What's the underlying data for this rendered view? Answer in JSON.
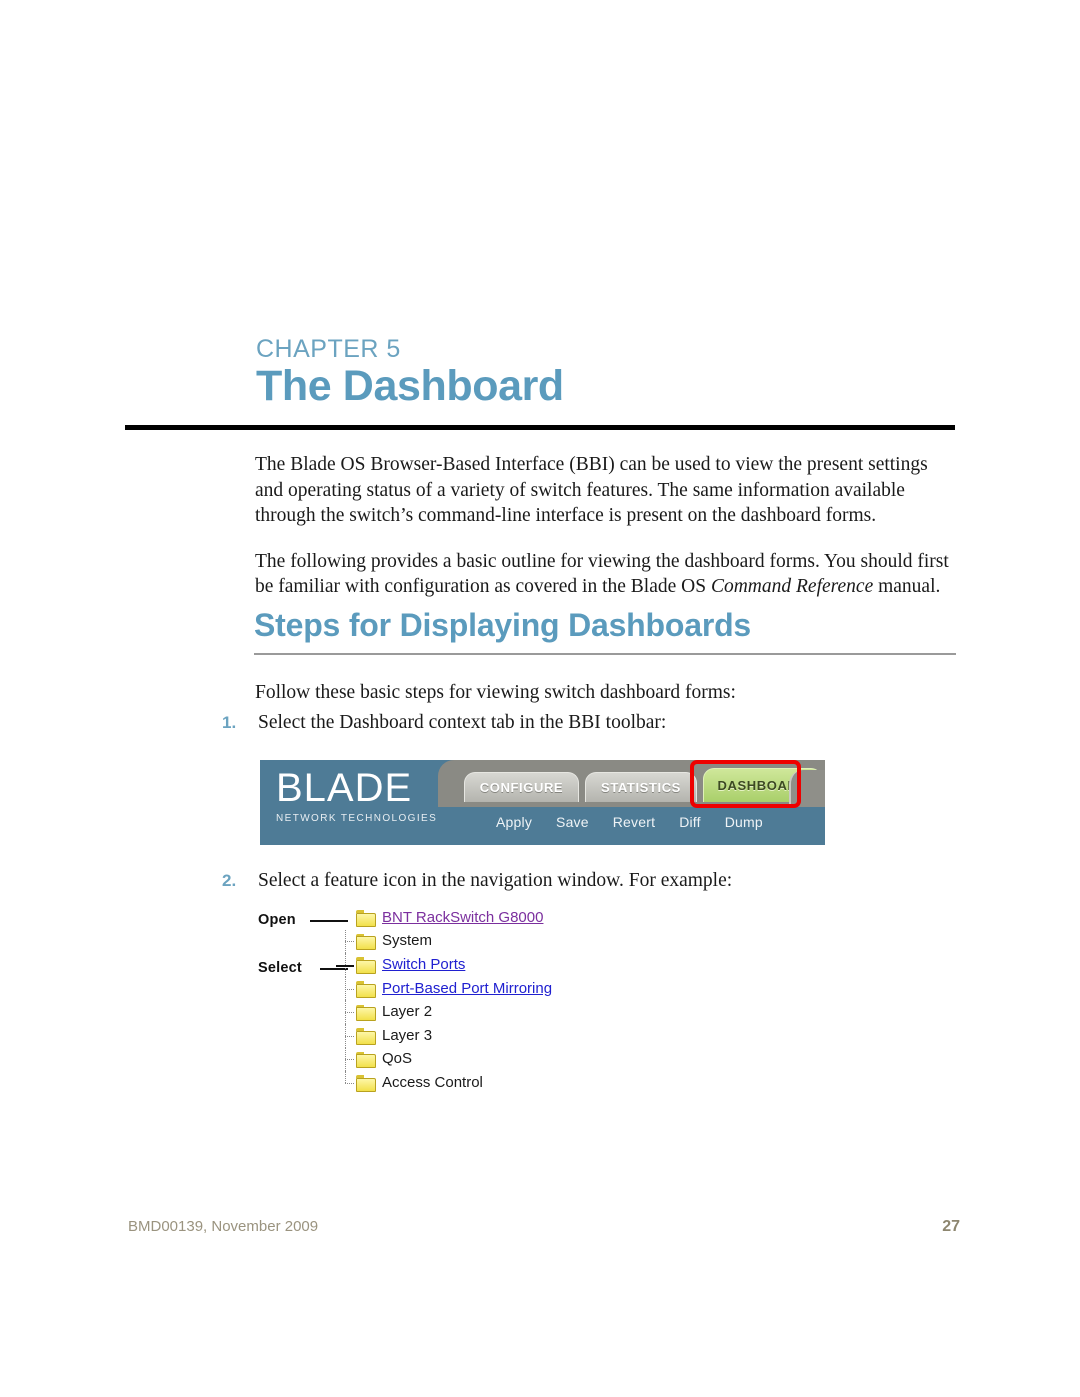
{
  "chapter": {
    "label_word": "Chapter",
    "number": "5",
    "title": "The Dashboard"
  },
  "intro": {
    "para1": "The Blade OS Browser-Based Interface (BBI) can be used to view the present settings and operating status of a variety of switch features. The same information available through the switch’s command-line interface is present on the dashboard forms.",
    "para2_before": "The following provides a basic outline for viewing the dashboard forms. You should first be familiar with configuration as covered in the Blade OS ",
    "para2_italic": "Command Reference",
    "para2_after": " manual."
  },
  "section": {
    "title": "Steps for Displaying Dashboards",
    "lead_in": "Follow these basic steps for viewing switch dashboard forms:"
  },
  "steps": [
    {
      "number": "1.",
      "text": "Select the Dashboard context tab in the BBI toolbar:"
    },
    {
      "number": "2.",
      "text": "Select a feature icon in the navigation window. For example:"
    }
  ],
  "bbi_toolbar": {
    "logo_word": "BLADE",
    "logo_tagline": "NETWORK TECHNOLOGIES",
    "tabs": [
      {
        "label": "CONFIGURE",
        "active": "false"
      },
      {
        "label": "STATISTICS",
        "active": "false"
      },
      {
        "label": "DASHBOARD",
        "active": "true"
      }
    ],
    "actions": [
      "Apply",
      "Save",
      "Revert",
      "Diff",
      "Dump"
    ],
    "highlight_color": "#ee0000",
    "background_color": "#4e7b96",
    "active_tab_color": "#a9cf6a"
  },
  "nav_tree": {
    "callouts": [
      {
        "label": "Open"
      },
      {
        "label": "Select"
      }
    ],
    "items": [
      {
        "label": "BNT RackSwitch G8000",
        "style": "link-visited",
        "level": "root"
      },
      {
        "label": "System",
        "style": "plain",
        "level": "child"
      },
      {
        "label": "Switch Ports",
        "style": "link",
        "level": "child"
      },
      {
        "label": "Port-Based Port Mirroring",
        "style": "link",
        "level": "child"
      },
      {
        "label": "Layer 2",
        "style": "plain",
        "level": "child"
      },
      {
        "label": "Layer 3",
        "style": "plain",
        "level": "child"
      },
      {
        "label": "QoS",
        "style": "plain",
        "level": "child"
      },
      {
        "label": "Access Control",
        "style": "plain",
        "level": "child"
      }
    ]
  },
  "footer": {
    "document_id": "BMD00139, November 2009",
    "page_number": "27"
  }
}
